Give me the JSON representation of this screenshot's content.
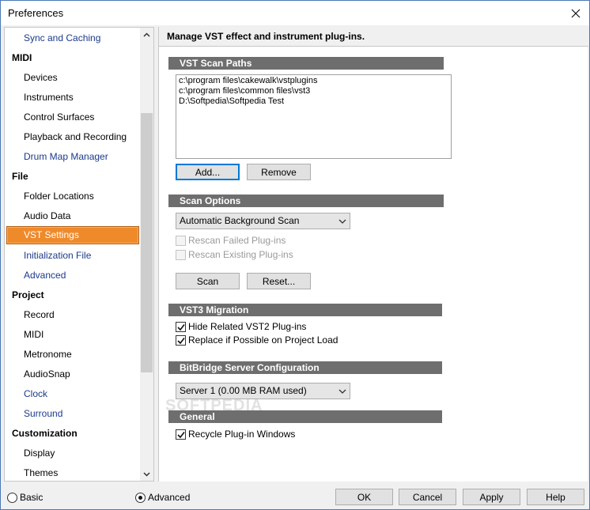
{
  "window": {
    "title": "Preferences"
  },
  "sidebar": {
    "items": [
      {
        "label": "Sync and Caching",
        "kind": "child",
        "style": "blue"
      },
      {
        "label": "MIDI",
        "kind": "group"
      },
      {
        "label": "Devices",
        "kind": "child"
      },
      {
        "label": "Instruments",
        "kind": "child"
      },
      {
        "label": "Control Surfaces",
        "kind": "child"
      },
      {
        "label": "Playback and Recording",
        "kind": "child"
      },
      {
        "label": "Drum Map Manager",
        "kind": "child",
        "style": "blue"
      },
      {
        "label": "File",
        "kind": "group"
      },
      {
        "label": "Folder Locations",
        "kind": "child"
      },
      {
        "label": "Audio Data",
        "kind": "child"
      },
      {
        "label": "VST Settings",
        "kind": "child",
        "selected": true
      },
      {
        "label": "Initialization File",
        "kind": "child",
        "style": "blue"
      },
      {
        "label": "Advanced",
        "kind": "child",
        "style": "blue"
      },
      {
        "label": "Project",
        "kind": "group"
      },
      {
        "label": "Record",
        "kind": "child"
      },
      {
        "label": "MIDI",
        "kind": "child"
      },
      {
        "label": "Metronome",
        "kind": "child"
      },
      {
        "label": "AudioSnap",
        "kind": "child"
      },
      {
        "label": "Clock",
        "kind": "child",
        "style": "blue"
      },
      {
        "label": "Surround",
        "kind": "child",
        "style": "blue"
      },
      {
        "label": "Customization",
        "kind": "group"
      },
      {
        "label": "Display",
        "kind": "child"
      },
      {
        "label": "Themes",
        "kind": "child"
      }
    ]
  },
  "main": {
    "header": "Manage VST effect and instrument plug-ins.",
    "scan_paths": {
      "title": "VST Scan Paths",
      "paths": [
        "c:\\program files\\cakewalk\\vstplugins",
        "c:\\program files\\common files\\vst3",
        "D:\\Softpedia\\Softpedia Test"
      ],
      "add_label": "Add...",
      "remove_label": "Remove"
    },
    "scan_options": {
      "title": "Scan Options",
      "mode_value": "Automatic Background Scan",
      "rescan_failed": "Rescan Failed Plug-ins",
      "rescan_existing": "Rescan Existing Plug-ins",
      "scan_label": "Scan",
      "reset_label": "Reset..."
    },
    "vst3_migration": {
      "title": "VST3 Migration",
      "hide_related": "Hide Related VST2 Plug-ins",
      "replace_if_possible": "Replace if Possible on Project Load"
    },
    "bitbridge": {
      "title": "BitBridge Server Configuration",
      "server_value": "Server 1  (0.00  MB RAM used)"
    },
    "general": {
      "title": "General",
      "recycle": "Recycle Plug-in Windows"
    },
    "watermark": "SOFTPEDIA"
  },
  "footer": {
    "basic_label": "Basic",
    "advanced_label": "Advanced",
    "ok_label": "OK",
    "cancel_label": "Cancel",
    "apply_label": "Apply",
    "help_label": "Help"
  },
  "colors": {
    "selection": "#ef8a2b",
    "section_bar": "#6e6e6e",
    "link_blue": "#1b3a8a",
    "focus_blue": "#0078d7"
  }
}
